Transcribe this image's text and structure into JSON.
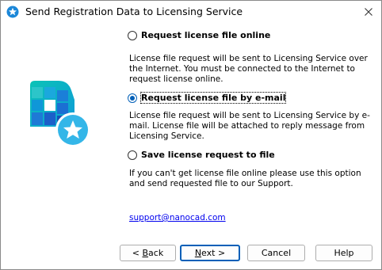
{
  "window": {
    "title": "Send Registration Data to Licensing Service"
  },
  "options": [
    {
      "label": "Request license file online",
      "checked": false,
      "description": "License file request will be sent to Licensing Service over the Internet. You must be connected to the Internet to request license online."
    },
    {
      "label": "Request license file by e-mail",
      "checked": true,
      "description": "License file request will be sent to Licensing Service by e-mail. License file will be attached to reply message from Licensing Service."
    },
    {
      "label": "Save license request to file",
      "checked": false,
      "description": "If you can't get license file online please use this option and send requested file to our Support."
    }
  ],
  "support_link": "support@nanocad.com",
  "buttons": {
    "back": {
      "prefix": "< ",
      "mnemonic": "B",
      "rest": "ack"
    },
    "next": {
      "mnemonic": "N",
      "rest": "ext >"
    },
    "cancel": "Cancel",
    "help": "Help"
  },
  "colors": {
    "accent": "#005fb8",
    "logo_blue": "#1b6fd3",
    "logo_cyan": "#34b6e8",
    "logo_teal": "#0bc3b6"
  }
}
